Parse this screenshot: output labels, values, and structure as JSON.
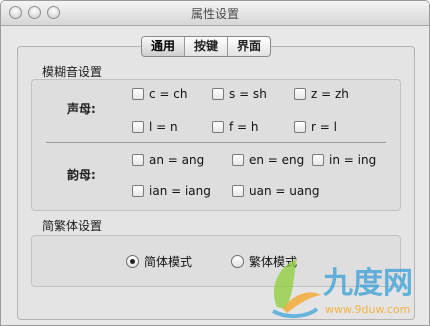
{
  "window": {
    "title": "属性设置"
  },
  "tabs": [
    {
      "label": "通用",
      "selected": true
    },
    {
      "label": "按键",
      "selected": false
    },
    {
      "label": "界面",
      "selected": false
    }
  ],
  "fuzzy": {
    "title": "模糊音设置",
    "initials": {
      "label": "声母:",
      "options": [
        {
          "label": "c = ch",
          "checked": false
        },
        {
          "label": "s = sh",
          "checked": false
        },
        {
          "label": "z = zh",
          "checked": false
        },
        {
          "label": "l = n",
          "checked": false
        },
        {
          "label": "f = h",
          "checked": false
        },
        {
          "label": "r = l",
          "checked": false
        }
      ]
    },
    "finals": {
      "label": "韵母:",
      "options": [
        {
          "label": "an = ang",
          "checked": false
        },
        {
          "label": "en = eng",
          "checked": false
        },
        {
          "label": "in = ing",
          "checked": false
        },
        {
          "label": "ian = iang",
          "checked": false
        },
        {
          "label": "uan = uang",
          "checked": false
        }
      ]
    }
  },
  "script_mode": {
    "title": "简繁体设置",
    "options": [
      {
        "label": "简体模式",
        "selected": true
      },
      {
        "label": "繁体模式",
        "selected": false
      }
    ]
  },
  "watermark": {
    "logo_text": "九度网",
    "url": "www.9duw.com"
  }
}
